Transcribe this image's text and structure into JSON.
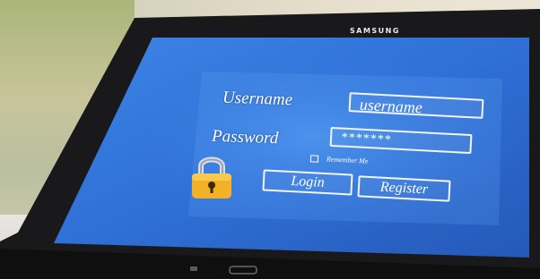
{
  "device": {
    "brand": "SAMSUNG"
  },
  "login_screen": {
    "username_label": "Username",
    "username_value": "username",
    "password_label": "Password",
    "password_value": "*******",
    "remember_label": "Remember Me",
    "remember_checked": false,
    "login_button": "Login",
    "register_button": "Register"
  },
  "icons": {
    "lock": "padlock-icon"
  },
  "colors": {
    "screen_blue": "#2f6fd6",
    "bezel": "#1a1a1c",
    "lock_gold": "#f2b126"
  }
}
